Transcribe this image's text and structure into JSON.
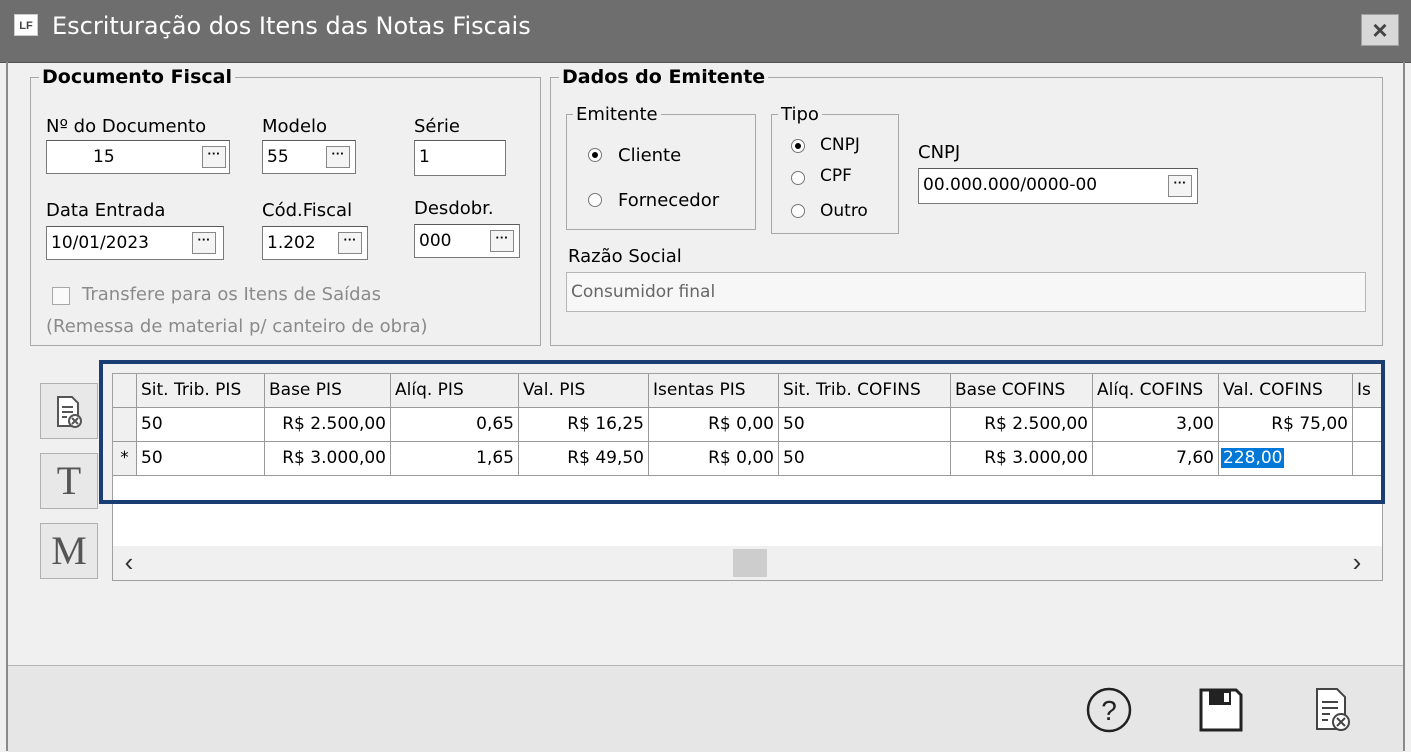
{
  "window": {
    "title": "Escrituração dos Itens das Notas Fiscais",
    "app_icon": "LF",
    "close_glyph": "×"
  },
  "documento_fiscal": {
    "legend": "Documento Fiscal",
    "numero_label": "Nº do Documento",
    "numero_value": "15",
    "modelo_label": "Modelo",
    "modelo_value": "55",
    "serie_label": "Série",
    "serie_value": "1",
    "data_label": "Data Entrada",
    "data_value": "10/01/2023",
    "cod_label": "Cód.Fiscal",
    "cod_value": "1.202",
    "desdobr_label": "Desdobr.",
    "desdobr_value": "000",
    "transfere_label": "Transfere para os Itens de Saídas",
    "remessa_label": "(Remessa de material p/ canteiro de obra)",
    "ellipsis": "···"
  },
  "dados_emitente": {
    "legend": "Dados do Emitente",
    "emitente_legend": "Emitente",
    "cliente_label": "Cliente",
    "fornecedor_label": "Fornecedor",
    "tipo_legend": "Tipo",
    "cnpj_opt": "CNPJ",
    "cpf_opt": "CPF",
    "outro_opt": "Outro",
    "cnpj_label": "CNPJ",
    "cnpj_value": "00.000.000/0000-00",
    "razao_label": "Razão Social",
    "razao_value": "Consumidor final"
  },
  "side_buttons": {
    "t_label": "T",
    "m_label": "M"
  },
  "grid": {
    "headers": [
      "Sit. Trib. PIS",
      "Base PIS",
      "Alíq. PIS",
      "Val. PIS",
      "Isentas PIS",
      "Sit. Trib. COFINS",
      "Base COFINS",
      "Alíq. COFINS",
      "Val. COFINS",
      "Is"
    ],
    "rows": [
      {
        "indicator": "",
        "cells": [
          "50",
          "R$ 2.500,00",
          "0,65",
          "R$ 16,25",
          "R$ 0,00",
          "50",
          "R$ 2.500,00",
          "3,00",
          "R$ 75,00",
          ""
        ]
      },
      {
        "indicator": "*",
        "cells": [
          "50",
          "R$ 3.000,00",
          "1,65",
          "R$ 49,50",
          "R$ 0,00",
          "50",
          "R$ 3.000,00",
          "7,60",
          "228,00",
          ""
        ]
      }
    ],
    "scroll_left": "‹",
    "scroll_right": "›"
  },
  "footer": {
    "help_icon": "?",
    "save_icon": "save",
    "cancel_icon": "cancel-document"
  }
}
